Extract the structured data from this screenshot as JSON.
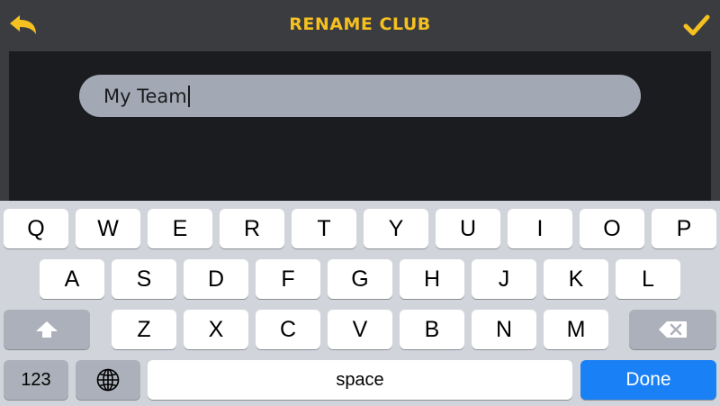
{
  "header": {
    "title": "RENAME CLUB",
    "back_icon": "undo-arrow-icon",
    "confirm_icon": "checkmark-icon",
    "accent_color": "#f5c120"
  },
  "name_field": {
    "value": "My Team"
  },
  "keyboard": {
    "row1": [
      "Q",
      "W",
      "E",
      "R",
      "T",
      "Y",
      "U",
      "I",
      "O",
      "P"
    ],
    "row2": [
      "A",
      "S",
      "D",
      "F",
      "G",
      "H",
      "J",
      "K",
      "L"
    ],
    "row3": [
      "Z",
      "X",
      "C",
      "V",
      "B",
      "N",
      "M"
    ],
    "shift_icon": "shift-arrow-icon",
    "backspace_icon": "backspace-icon",
    "numbers_label": "123",
    "globe_icon": "globe-icon",
    "space_label": "space",
    "done_label": "Done",
    "done_color": "#1a80f5"
  }
}
